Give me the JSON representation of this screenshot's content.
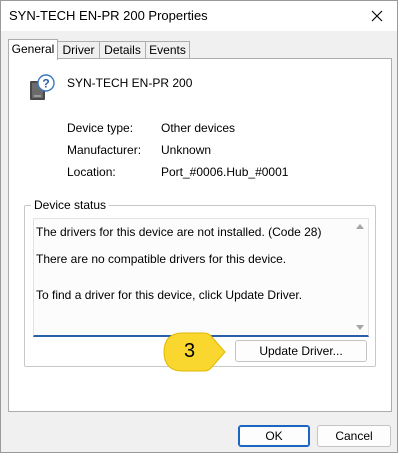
{
  "window": {
    "title": "SYN-TECH EN-PR 200 Properties"
  },
  "tabs": [
    {
      "label": "General",
      "active": true
    },
    {
      "label": "Driver",
      "active": false
    },
    {
      "label": "Details",
      "active": false
    },
    {
      "label": "Events",
      "active": false
    }
  ],
  "device": {
    "icon": "unknown-device-icon",
    "name": "SYN-TECH EN-PR 200",
    "properties": [
      {
        "label": "Device type:",
        "value": "Other devices"
      },
      {
        "label": "Manufacturer:",
        "value": "Unknown"
      },
      {
        "label": "Location:",
        "value": "Port_#0006.Hub_#0001"
      }
    ]
  },
  "status": {
    "group_label": "Device status",
    "lines": [
      "The drivers for this device are not installed. (Code 28)",
      "There are no compatible drivers for this device.",
      "To find a driver for this device, click Update Driver."
    ]
  },
  "buttons": {
    "update_driver": "Update Driver...",
    "ok": "OK",
    "cancel": "Cancel"
  },
  "callout": {
    "number": "3",
    "color": "#f9d72f"
  },
  "colors": {
    "accent": "#1a66c2",
    "status_underline": "#2b5fa8"
  }
}
